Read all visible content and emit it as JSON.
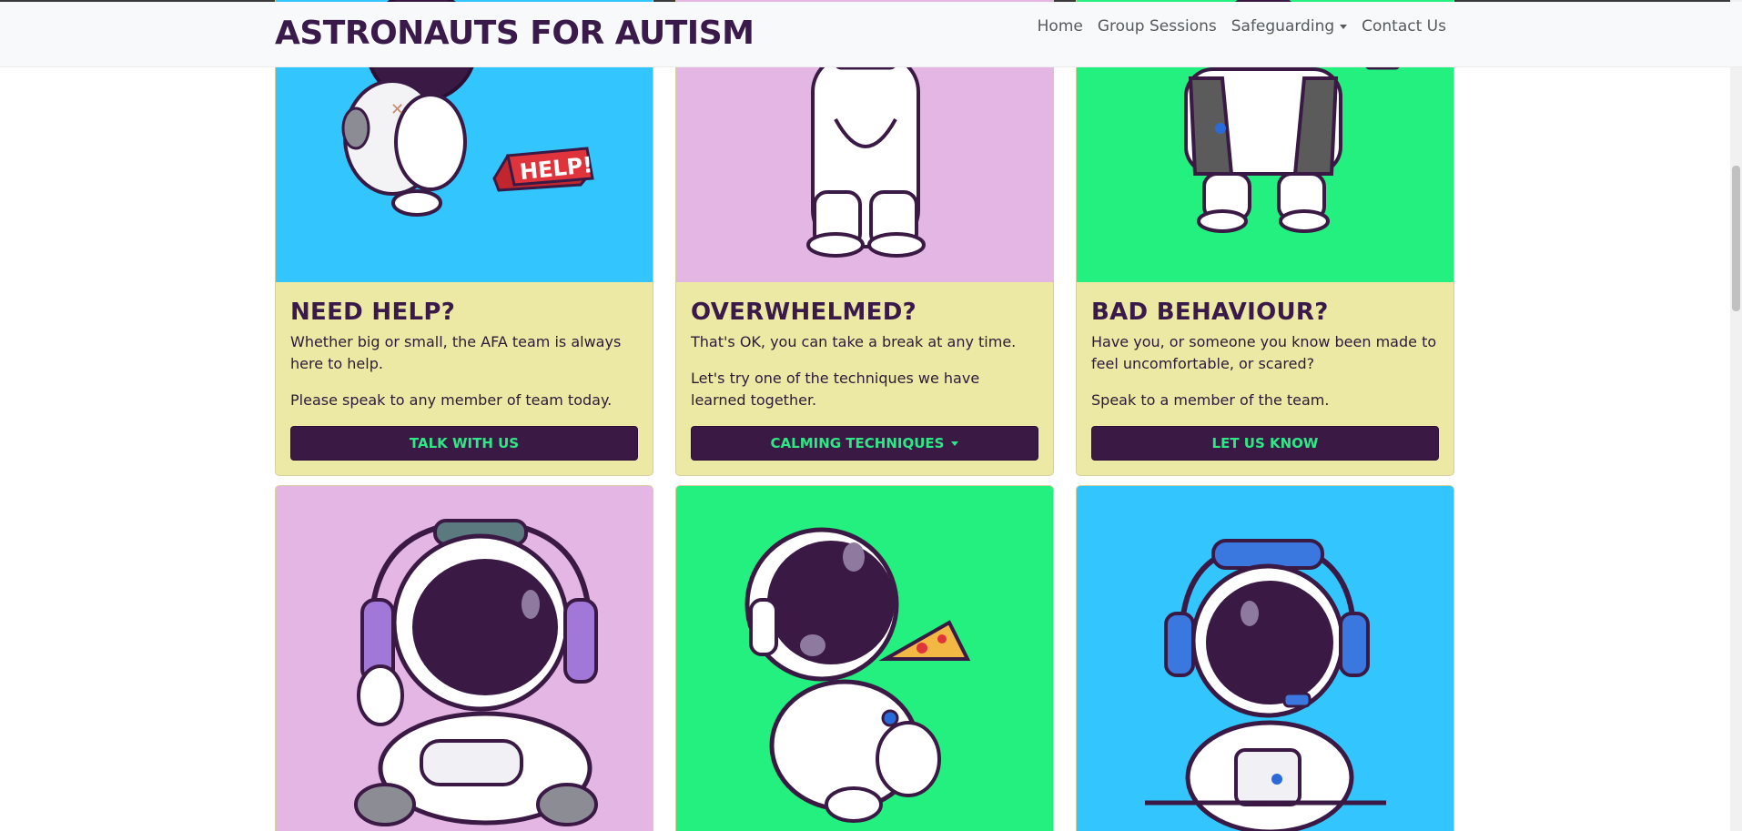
{
  "brand": {
    "name": "ASTRONAUTS FOR AUTISM"
  },
  "nav": {
    "items": [
      {
        "label": "Home"
      },
      {
        "label": "Group Sessions"
      },
      {
        "label": "Safeguarding",
        "dropdown": true
      },
      {
        "label": "Contact Us"
      }
    ]
  },
  "cards": [
    {
      "image": "astronaut-help-sign-illustration",
      "bg": "#33c6fe",
      "title": "NEED HELP?",
      "texts": [
        "Whether big or small, the AFA team is always here to help.",
        "Please speak to any member of team today."
      ],
      "button": "TALK WITH US"
    },
    {
      "image": "astronaut-standing-illustration",
      "bg": "#e4b6e4",
      "title": "OVERWHELMED?",
      "texts": [
        "That's OK, you can take a break at any time.",
        "Let's try one of the techniques we have learned together."
      ],
      "button": "CALMING TECHNIQUES",
      "button_dropdown": true
    },
    {
      "image": "astronaut-jacket-illustration",
      "bg": "#23f07e",
      "title": "BAD BEHAVIOUR?",
      "texts": [
        "Have you, or someone you know been made to feel uncomfortable, or scared?",
        "Speak to a member of the team."
      ],
      "button": "LET US KNOW"
    },
    {
      "image": "astronaut-gaming-headset-illustration",
      "bg": "#e4b6e4"
    },
    {
      "image": "astronaut-eating-pizza-illustration",
      "bg": "#23f07e"
    },
    {
      "image": "astronaut-headphones-laptop-illustration",
      "bg": "#33c6fe"
    }
  ],
  "colors": {
    "card_body": "#ebe9a3",
    "button_bg": "#3a1a45",
    "button_text": "#2ee886",
    "brand_text": "#3a1a4a"
  }
}
